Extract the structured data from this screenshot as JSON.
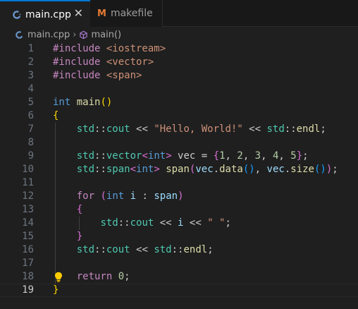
{
  "tabs": [
    {
      "label": "main.cpp",
      "active": true,
      "icon": "cpp-file-icon"
    },
    {
      "label": "makefile",
      "active": false,
      "icon": "makefile-icon"
    }
  ],
  "breadcrumb": {
    "file": "main.cpp",
    "symbol": "main()"
  },
  "editor": {
    "current_line": 19,
    "lines": [
      {
        "n": "1",
        "t": [
          [
            "#include ",
            "kw-pre"
          ],
          [
            "<iostream>",
            "inc"
          ]
        ]
      },
      {
        "n": "2",
        "t": [
          [
            "#include ",
            "kw-pre"
          ],
          [
            "<vector>",
            "inc"
          ]
        ]
      },
      {
        "n": "3",
        "t": [
          [
            "#include ",
            "kw-pre"
          ],
          [
            "<span>",
            "inc"
          ]
        ]
      },
      {
        "n": "4",
        "t": []
      },
      {
        "n": "5",
        "t": [
          [
            "int",
            "kw"
          ],
          [
            " ",
            ""
          ],
          [
            "main",
            "fn"
          ],
          [
            "()",
            "b1"
          ]
        ]
      },
      {
        "n": "6",
        "t": [
          [
            "{",
            "b1"
          ]
        ]
      },
      {
        "n": "7",
        "t": [
          [
            "    ",
            ""
          ],
          [
            "std",
            "ns"
          ],
          [
            "::",
            ""
          ],
          [
            "cout",
            "ns"
          ],
          [
            " << ",
            ""
          ],
          [
            "\"Hello, World!\"",
            "str"
          ],
          [
            " << ",
            ""
          ],
          [
            "std",
            "ns"
          ],
          [
            "::",
            ""
          ],
          [
            "endl",
            "fn"
          ],
          [
            ";",
            ""
          ]
        ]
      },
      {
        "n": "8",
        "t": []
      },
      {
        "n": "9",
        "t": [
          [
            "    ",
            ""
          ],
          [
            "std",
            "ns"
          ],
          [
            "::",
            ""
          ],
          [
            "vector",
            "ns"
          ],
          [
            "<",
            "b2"
          ],
          [
            "int",
            "kw"
          ],
          [
            ">",
            "b2"
          ],
          [
            " vec = ",
            ""
          ],
          [
            "{",
            "b2"
          ],
          [
            "1",
            "num"
          ],
          [
            ", ",
            ""
          ],
          [
            "2",
            "num"
          ],
          [
            ", ",
            ""
          ],
          [
            "3",
            "num"
          ],
          [
            ", ",
            ""
          ],
          [
            "4",
            "num"
          ],
          [
            ", ",
            ""
          ],
          [
            "5",
            "num"
          ],
          [
            "}",
            "b2"
          ],
          [
            ";",
            ""
          ]
        ]
      },
      {
        "n": "10",
        "t": [
          [
            "    ",
            ""
          ],
          [
            "std",
            "ns"
          ],
          [
            "::",
            ""
          ],
          [
            "span",
            "ns"
          ],
          [
            "<",
            "b2"
          ],
          [
            "int",
            "kw"
          ],
          [
            ">",
            "b2"
          ],
          [
            " ",
            ""
          ],
          [
            "span",
            "fn"
          ],
          [
            "(",
            "b2"
          ],
          [
            "vec",
            "var"
          ],
          [
            ".",
            ""
          ],
          [
            "data",
            "fn"
          ],
          [
            "()",
            "b3"
          ],
          [
            ", ",
            ""
          ],
          [
            "vec",
            "var"
          ],
          [
            ".",
            ""
          ],
          [
            "size",
            "fn"
          ],
          [
            "()",
            "b3"
          ],
          [
            ")",
            "b2"
          ],
          [
            ";",
            ""
          ]
        ]
      },
      {
        "n": "11",
        "t": []
      },
      {
        "n": "12",
        "t": [
          [
            "    ",
            ""
          ],
          [
            "for",
            "ctl"
          ],
          [
            " ",
            ""
          ],
          [
            "(",
            "b2"
          ],
          [
            "int",
            "kw"
          ],
          [
            " ",
            ""
          ],
          [
            "i",
            "var"
          ],
          [
            " : ",
            ""
          ],
          [
            "span",
            "var"
          ],
          [
            ")",
            "b2"
          ]
        ]
      },
      {
        "n": "13",
        "t": [
          [
            "    ",
            ""
          ],
          [
            "{",
            "b2"
          ]
        ]
      },
      {
        "n": "14",
        "t": [
          [
            "        ",
            ""
          ],
          [
            "std",
            "ns"
          ],
          [
            "::",
            ""
          ],
          [
            "cout",
            "ns"
          ],
          [
            " << ",
            ""
          ],
          [
            "i",
            "var"
          ],
          [
            " << ",
            ""
          ],
          [
            "\" \"",
            "str"
          ],
          [
            ";",
            ""
          ]
        ]
      },
      {
        "n": "15",
        "t": [
          [
            "    ",
            ""
          ],
          [
            "}",
            "b2"
          ]
        ]
      },
      {
        "n": "16",
        "t": [
          [
            "    ",
            ""
          ],
          [
            "std",
            "ns"
          ],
          [
            "::",
            ""
          ],
          [
            "cout",
            "ns"
          ],
          [
            " << ",
            ""
          ],
          [
            "std",
            "ns"
          ],
          [
            "::",
            ""
          ],
          [
            "endl",
            "fn"
          ],
          [
            ";",
            ""
          ]
        ]
      },
      {
        "n": "17",
        "t": []
      },
      {
        "n": "18",
        "t": [
          [
            "    ",
            ""
          ],
          [
            "return",
            "ctl"
          ],
          [
            " ",
            ""
          ],
          [
            "0",
            "num"
          ],
          [
            ";",
            ""
          ]
        ]
      },
      {
        "n": "19",
        "t": [
          [
            "}",
            "b1"
          ]
        ]
      }
    ]
  },
  "colors": {
    "accent": "#0078d4",
    "background": "#1f1f1f",
    "tabbar": "#181818"
  }
}
